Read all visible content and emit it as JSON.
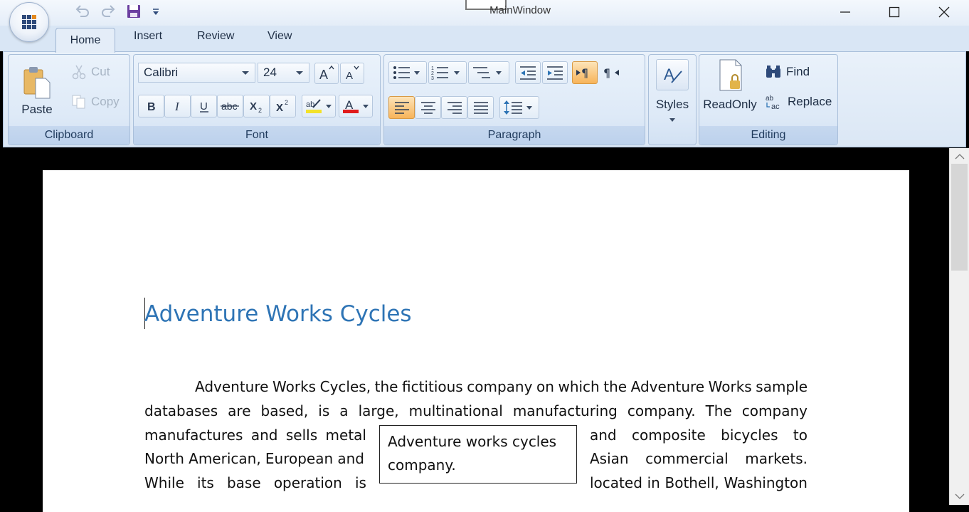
{
  "window": {
    "title": "MainWindow"
  },
  "quick_access": {
    "items": [
      "undo-icon",
      "redo-icon",
      "save-icon",
      "customize-dropdown-icon"
    ]
  },
  "tabs": [
    {
      "label": "Home",
      "active": true
    },
    {
      "label": "Insert"
    },
    {
      "label": "Review"
    },
    {
      "label": "View"
    }
  ],
  "clipboard": {
    "group_label": "Clipboard",
    "paste": "Paste",
    "cut": "Cut",
    "copy": "Copy"
  },
  "font": {
    "group_label": "Font",
    "family": "Calibri",
    "size": "24"
  },
  "paragraph": {
    "group_label": "Paragraph"
  },
  "styles": {
    "label": "Styles"
  },
  "editing": {
    "group_label": "Editing",
    "readonly": "ReadOnly",
    "find": "Find",
    "replace": "Replace"
  },
  "document": {
    "heading": "Adventure Works Cycles",
    "line1_words": [
      "Adventure",
      "Works",
      "Cycles,",
      "the",
      "fictitious",
      "company",
      "on",
      "which",
      "the",
      "Adventure",
      "Works",
      "sample"
    ],
    "line2_words": [
      "databases",
      "are",
      "based,",
      "is",
      "a",
      "large,",
      "multinational",
      "manufacturing",
      "company.",
      "The",
      "company"
    ],
    "line3_left_words": [
      "manufactures",
      "and",
      "sells",
      "metal"
    ],
    "line3_right_words": [
      "and",
      "composite",
      "bicycles",
      "to"
    ],
    "line4_left_words": [
      "North",
      "American,",
      "European",
      "and"
    ],
    "line4_right_words": [
      "Asian",
      "commercial",
      "markets."
    ],
    "line5_left_words": [
      "While",
      "its",
      "base",
      "operation",
      "is"
    ],
    "line5_right_words": [
      "located",
      "in",
      "Bothell,",
      "Washington"
    ],
    "textbox": "Adventure works cycles company."
  },
  "colors": {
    "accent": "#2e74b5",
    "ribbon": "#dbe7f5",
    "highlight": "#f7b45a"
  }
}
